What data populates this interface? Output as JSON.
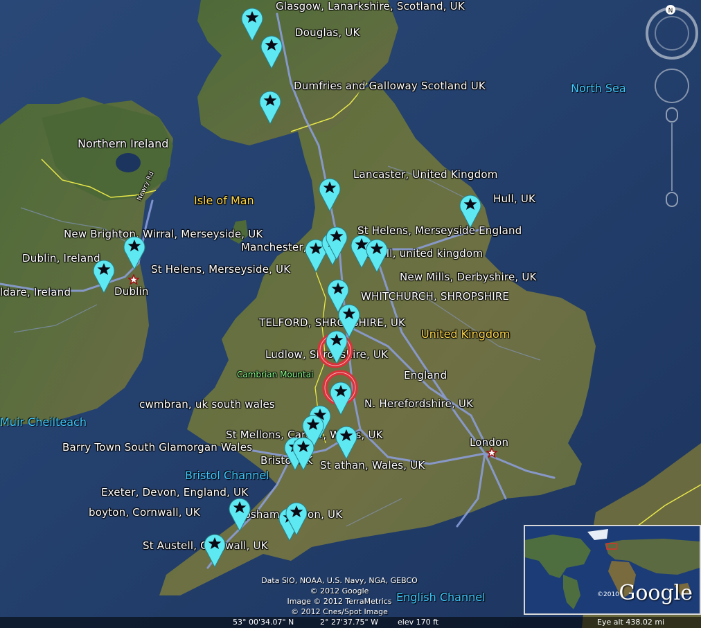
{
  "place_labels": {
    "glasgow": "Glasgow, Lanarkshire, Scotland, UK",
    "douglas": "Douglas, UK",
    "dumfries": "Dumfries and Galloway Scotland UK",
    "lancaster": "Lancaster, United Kingdom",
    "hull": "Hull, UK",
    "new_brighton": "New Brighton, Wirral, Merseyside, UK",
    "st_helens_england": "St Helens, Merseyside England",
    "manchester": "Manchester, UK",
    "rainhill": "rainhill, united kingdom",
    "dublin_ireland": "Dublin, Ireland",
    "st_helens_uk": "St Helens, Merseyside, UK",
    "new_mills": "New Mills, Derbyshire, UK",
    "kildare": "ldare, Ireland",
    "dublin": "Dublin",
    "whitchurch": "WHITCHURCH, SHROPSHIRE",
    "telford": "TELFORD, SHROPSHIRE, UK",
    "ludlow": "Ludlow, Shropshire, UK",
    "cwmbran": "cwmbran, uk south wales",
    "n_herefordshire": "N. Herefordshire, UK",
    "st_mellons": "St Mellons, Cardiff, Wales, UK",
    "barry": "Barry Town South Glamorgan Wales",
    "bristol": "Bristol UK",
    "st_athan": "St athan, Wales, UK",
    "london": "London",
    "exeter": "Exeter, Devon, England, UK",
    "boyton": "boyton, Cornwall, UK",
    "topsham": "Topsham, Devon, UK",
    "st_austell": "St Austell, Cornwall, UK"
  },
  "region_labels": {
    "northern_ireland": "Northern Ireland",
    "isle_of_man": "Isle of Man",
    "united_kingdom": "United Kingdom",
    "england": "England",
    "cambrian": "Cambrian Mountai",
    "newry_rd": "Newry Rd"
  },
  "water_labels": {
    "north_sea": "North Sea",
    "muir": "Muir Cheilteach",
    "bristol_channel": "Bristol Channel",
    "english_channel": "English Channel"
  },
  "credits": {
    "line1": "Data SIO, NOAA, U.S. Navy, NGA, GEBCO",
    "line2": "© 2012 Google",
    "line3": "Image © 2012 TerraMetrics",
    "line4": "© 2012 Cnes/Spot Image"
  },
  "status": {
    "latitude": "53° 00'34.07\" N",
    "longitude": "2° 27'37.75\" W",
    "elevation": "elev  170 ft",
    "eye_alt": "Eye alt  438.02 mi"
  },
  "overview": {
    "logo": "Google",
    "year": "©2010"
  },
  "compass": {
    "north": "N"
  },
  "colors": {
    "sea": "#1f3a68",
    "land_green": "#4d6b34",
    "land_brown": "#6e6a45",
    "pin": "#5ee8f2",
    "pin_selected": "#d9323a",
    "road": "#8da0e0",
    "border": "#e8e84a"
  }
}
